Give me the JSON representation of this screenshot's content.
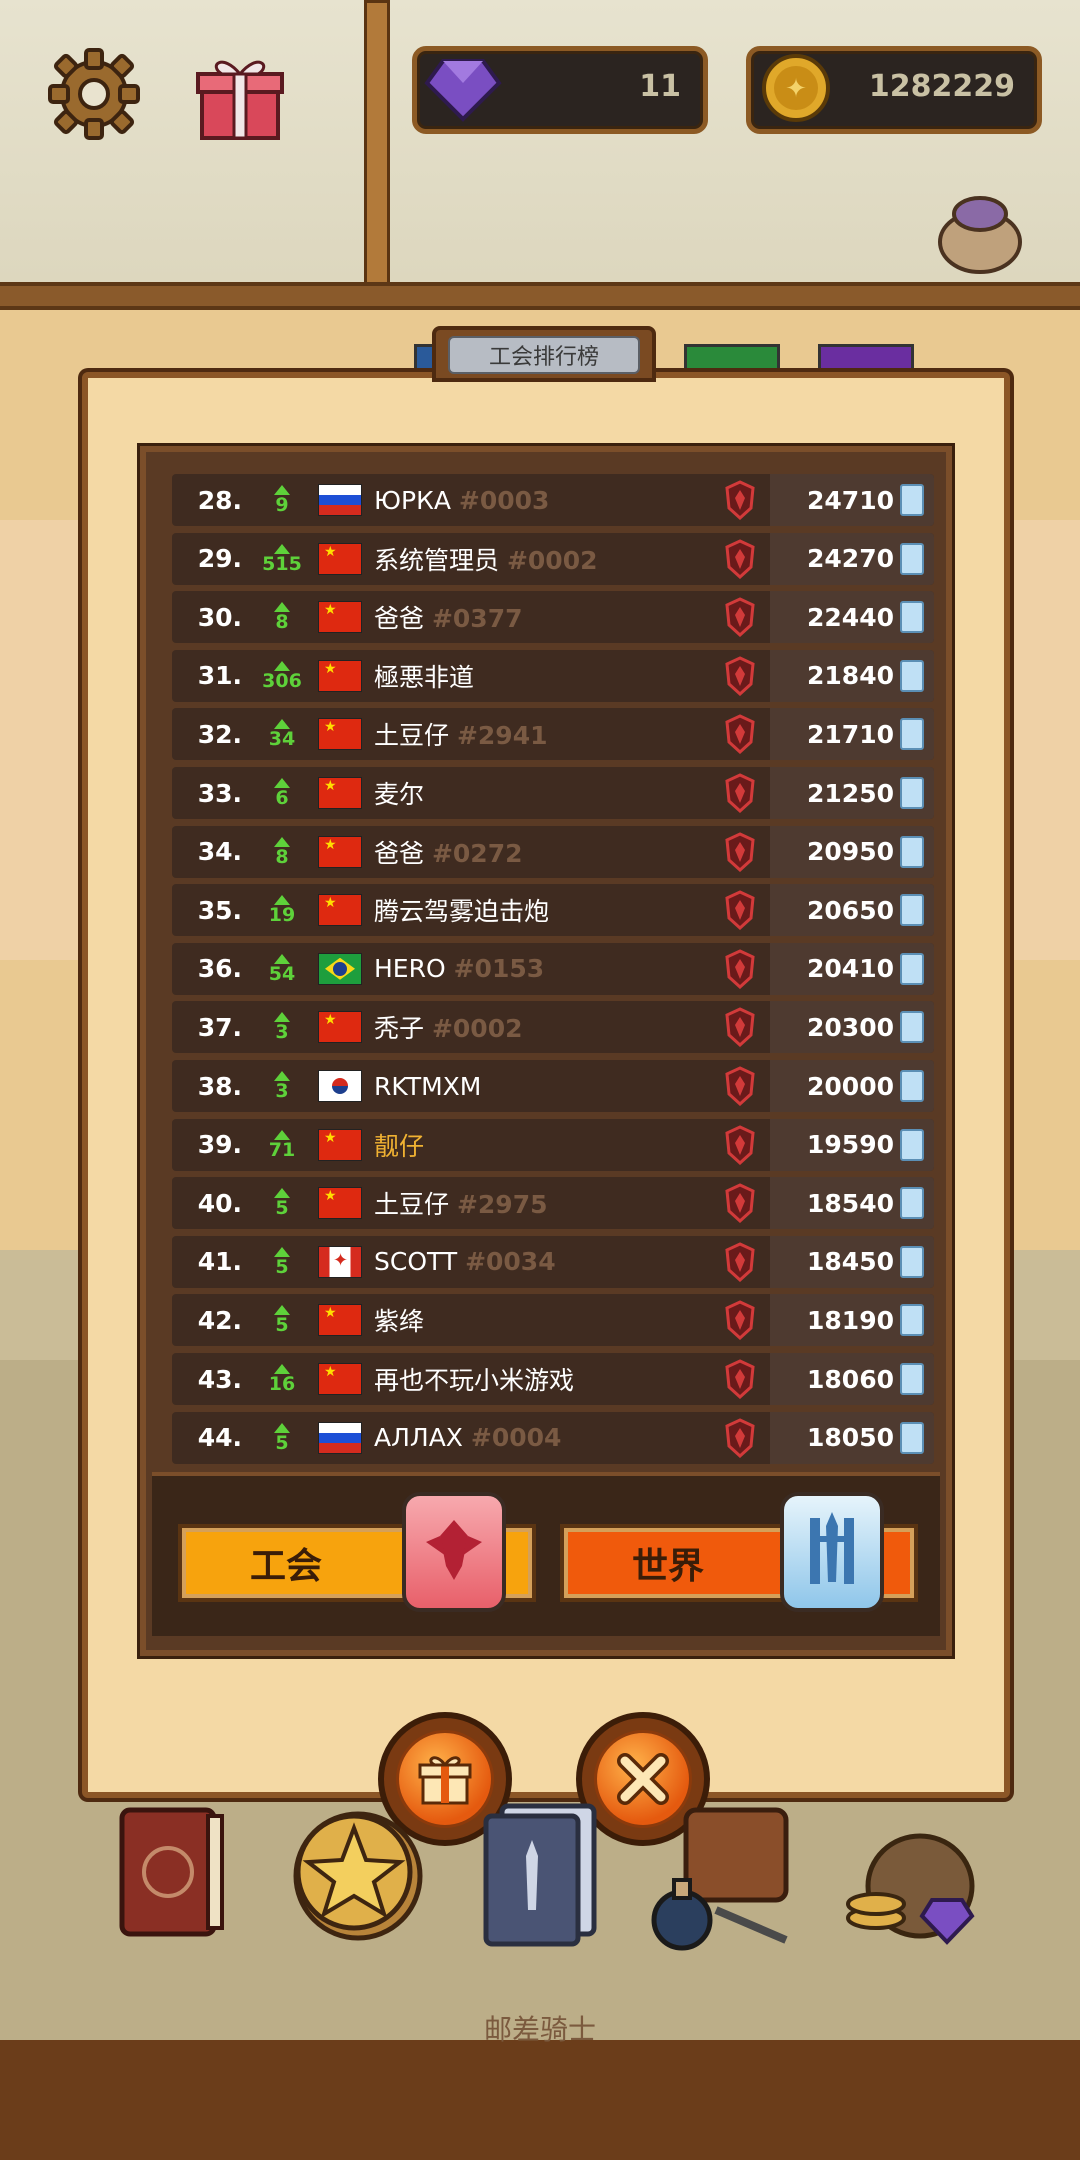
{
  "header": {
    "gems": "11",
    "coins": "1282229"
  },
  "panel": {
    "title": "工会排行榜"
  },
  "leaderboard": [
    {
      "rank": "28.",
      "change": "9",
      "flag": "ru",
      "name": "ЮРКА",
      "tag": "#0003",
      "score": "24710"
    },
    {
      "rank": "29.",
      "change": "515",
      "flag": "cn",
      "name": "系统管理员",
      "tag": "#0002",
      "score": "24270"
    },
    {
      "rank": "30.",
      "change": "8",
      "flag": "cn",
      "name": "爸爸",
      "tag": "#0377",
      "score": "22440"
    },
    {
      "rank": "31.",
      "change": "306",
      "flag": "cn",
      "name": "極悪非道",
      "tag": "",
      "score": "21840"
    },
    {
      "rank": "32.",
      "change": "34",
      "flag": "cn",
      "name": "土豆仔",
      "tag": "#2941",
      "score": "21710"
    },
    {
      "rank": "33.",
      "change": "6",
      "flag": "cn",
      "name": "麦尔",
      "tag": "",
      "score": "21250"
    },
    {
      "rank": "34.",
      "change": "8",
      "flag": "cn",
      "name": "爸爸",
      "tag": "#0272",
      "score": "20950"
    },
    {
      "rank": "35.",
      "change": "19",
      "flag": "cn",
      "name": "腾云驾雾迫击炮",
      "tag": "",
      "score": "20650"
    },
    {
      "rank": "36.",
      "change": "54",
      "flag": "br",
      "name": "HERO",
      "tag": "#0153",
      "score": "20410"
    },
    {
      "rank": "37.",
      "change": "3",
      "flag": "cn",
      "name": "秃子",
      "tag": "#0002",
      "score": "20300"
    },
    {
      "rank": "38.",
      "change": "3",
      "flag": "kr",
      "name": "RKTMXM",
      "tag": "",
      "score": "20000"
    },
    {
      "rank": "39.",
      "change": "71",
      "flag": "cn",
      "name": "靓仔",
      "tag": "",
      "score": "19590",
      "highlight": true
    },
    {
      "rank": "40.",
      "change": "5",
      "flag": "cn",
      "name": "土豆仔",
      "tag": "#2975",
      "score": "18540"
    },
    {
      "rank": "41.",
      "change": "5",
      "flag": "ca",
      "name": "SCOTT",
      "tag": "#0034",
      "score": "18450"
    },
    {
      "rank": "42.",
      "change": "5",
      "flag": "cn",
      "name": "紫绛",
      "tag": "",
      "score": "18190"
    },
    {
      "rank": "43.",
      "change": "16",
      "flag": "cn",
      "name": "再也不玩小米游戏",
      "tag": "",
      "score": "18060"
    },
    {
      "rank": "44.",
      "change": "5",
      "flag": "ru",
      "name": "АЛЛАХ",
      "tag": "#0004",
      "score": "18050"
    }
  ],
  "tabs": {
    "guild": "工会",
    "world": "世界"
  },
  "footer": {
    "caption": "邮差骑士"
  },
  "colors": {
    "guild_tab": "#f7a30d",
    "world_tab": "#f05a0c",
    "rank_up": "#5ed13a",
    "highlight_name": "#f0b232"
  }
}
